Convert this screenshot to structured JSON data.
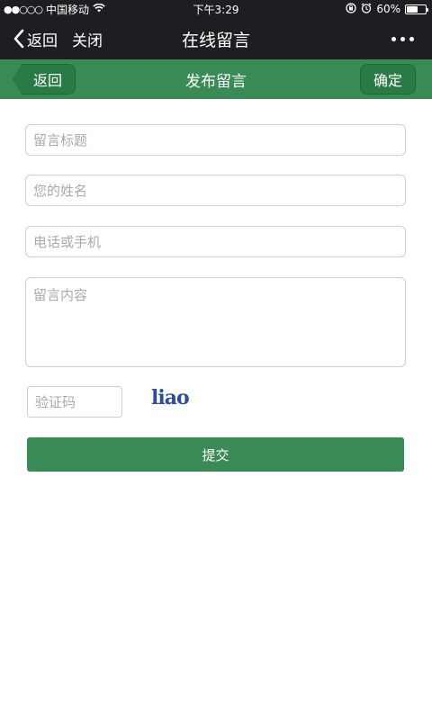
{
  "status": {
    "carrier": "中国移动",
    "time": "下午3:29",
    "battery": "60%",
    "battery_level": 0.6
  },
  "wx_nav": {
    "back_label": "返回",
    "close_label": "关闭",
    "title": "在线留言"
  },
  "header": {
    "back_label": "返回",
    "title": "发布留言",
    "confirm_label": "确定"
  },
  "form": {
    "title_placeholder": "留言标题",
    "name_placeholder": "您的姓名",
    "phone_placeholder": "电话或手机",
    "content_placeholder": "留言内容",
    "captcha_placeholder": "验证码",
    "captcha_text": "liao",
    "submit_label": "提交"
  }
}
